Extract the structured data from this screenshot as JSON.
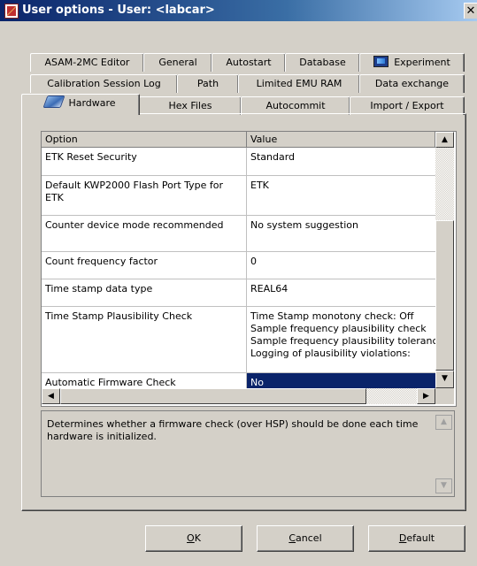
{
  "window": {
    "title": "User options - User: <labcar>",
    "close_glyph": "✕"
  },
  "tabs": {
    "row1": [
      {
        "label": "ASAM-2MC Editor"
      },
      {
        "label": "General"
      },
      {
        "label": "Autostart"
      },
      {
        "label": "Database"
      },
      {
        "label": "Experiment",
        "icon": "experiment-icon"
      }
    ],
    "row2": [
      {
        "label": "Calibration Session Log"
      },
      {
        "label": "Path"
      },
      {
        "label": "Limited EMU RAM"
      },
      {
        "label": "Data exchange"
      }
    ],
    "row3": [
      {
        "label": "Hardware",
        "icon": "hardware-icon",
        "selected": true
      },
      {
        "label": "Hex Files"
      },
      {
        "label": "Autocommit"
      },
      {
        "label": "Import / Export"
      }
    ]
  },
  "grid": {
    "columns": [
      "Option",
      "Value"
    ],
    "rows": [
      {
        "option": "ETK Reset Security",
        "value": "Standard"
      },
      {
        "option": "Default KWP2000 Flash Port Type for ETK",
        "value": "ETK"
      },
      {
        "option": "Counter device mode recommended",
        "value": "No system suggestion"
      },
      {
        "option": "Count frequency factor",
        "value": "0"
      },
      {
        "option": "Time stamp data type",
        "value": "REAL64"
      },
      {
        "option": "Time Stamp Plausibility Check",
        "value": "Time Stamp monotony check: Off\nSample frequency plausibility check\nSample frequency plausibility tolerance\nLogging of plausibility violations:"
      },
      {
        "option": "Automatic Firmware Check",
        "value": "No",
        "selected": true
      }
    ],
    "scroll_up_glyph": "▲",
    "scroll_down_glyph": "▼",
    "scroll_left_glyph": "◀",
    "scroll_right_glyph": "▶"
  },
  "description": {
    "text": "Determines whether a firmware check (over HSP) should be done each time hardware is initialized."
  },
  "buttons": {
    "ok": {
      "mnemonic": "O",
      "rest": "K"
    },
    "cancel": {
      "mnemonic": "C",
      "rest": "ancel"
    },
    "default": {
      "mnemonic": "D",
      "rest": "efault"
    }
  },
  "colors": {
    "selection": "#0a246a",
    "titlebar_start": "#0a246a",
    "face": "#d4d0c8"
  }
}
